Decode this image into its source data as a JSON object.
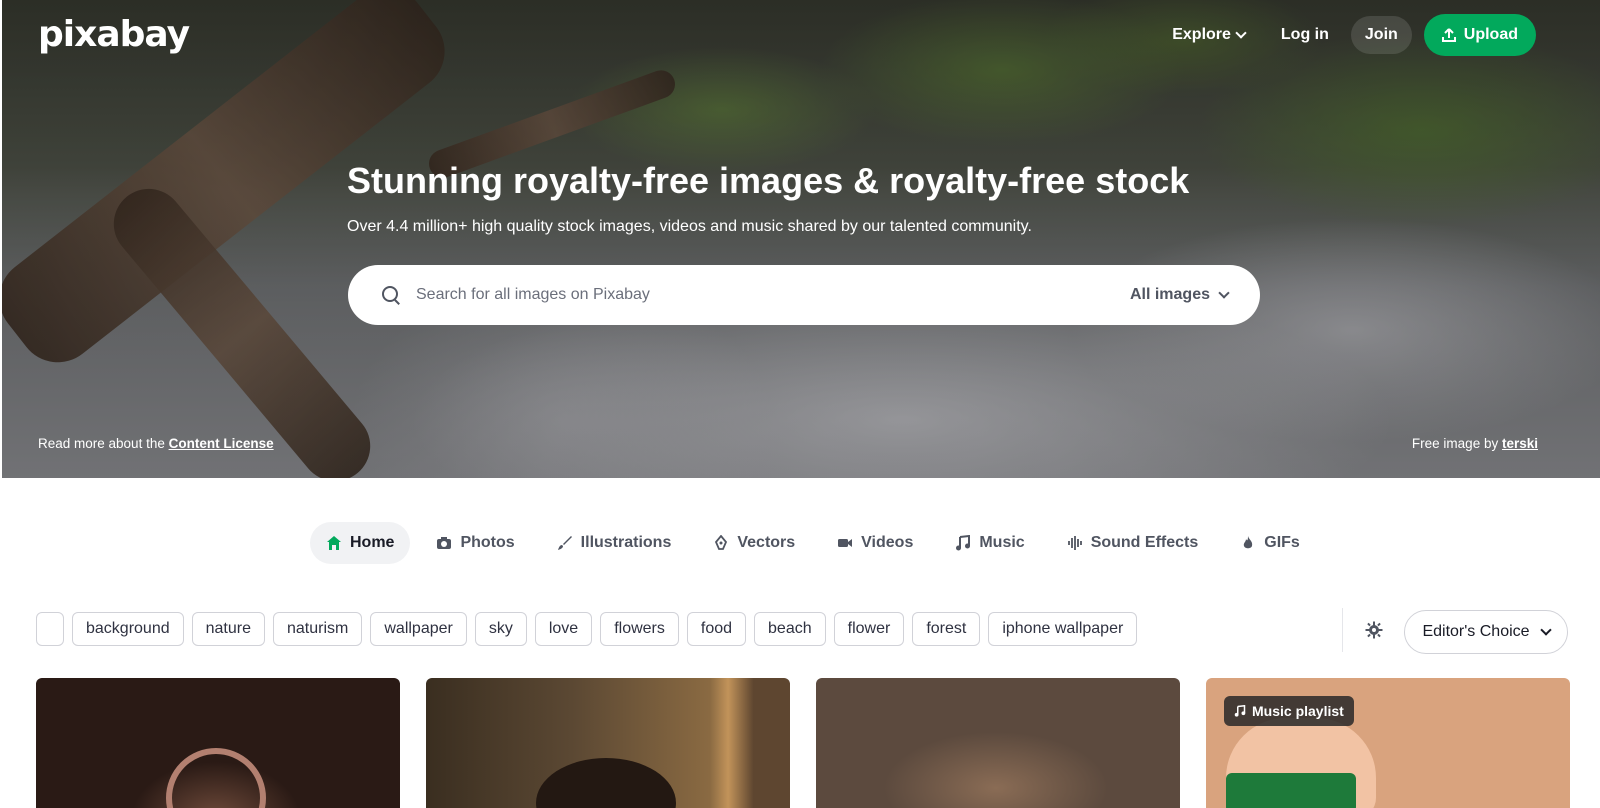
{
  "brand": {
    "logo_text": "pixabay"
  },
  "topnav": {
    "explore_label": "Explore",
    "login_label": "Log in",
    "join_label": "Join",
    "upload_label": "Upload"
  },
  "hero": {
    "title": "Stunning royalty-free images & royalty-free stock",
    "subtitle": "Over 4.4 million+ high quality stock images, videos and music shared by our talented community.",
    "search_placeholder": "Search for all images on Pixabay",
    "search_type": "All images",
    "license_prefix": "Read more about the ",
    "license_link": "Content License",
    "credit_prefix": "Free image by ",
    "credit_author": "terski"
  },
  "tabs": [
    {
      "label": "Home",
      "icon": "home-icon",
      "active": true
    },
    {
      "label": "Photos",
      "icon": "camera-icon"
    },
    {
      "label": "Illustrations",
      "icon": "brush-icon"
    },
    {
      "label": "Vectors",
      "icon": "pen-nib-icon"
    },
    {
      "label": "Videos",
      "icon": "video-camera-icon"
    },
    {
      "label": "Music",
      "icon": "music-note-icon"
    },
    {
      "label": "Sound Effects",
      "icon": "sound-wave-icon"
    },
    {
      "label": "GIFs",
      "icon": "flame-icon"
    }
  ],
  "tags": [
    "background",
    "nature",
    "naturism",
    "wallpaper",
    "sky",
    "love",
    "flowers",
    "food",
    "beach",
    "flower",
    "forest",
    "iphone wallpaper"
  ],
  "sort": {
    "label": "Editor's Choice"
  },
  "cards": [
    {
      "badge": ""
    },
    {
      "badge": ""
    },
    {
      "badge": ""
    },
    {
      "badge": "Music playlist"
    }
  ],
  "colors": {
    "accent": "#02a95c",
    "text": "#191b26",
    "muted": "#505561",
    "tag_border": "#d1d2d8"
  }
}
